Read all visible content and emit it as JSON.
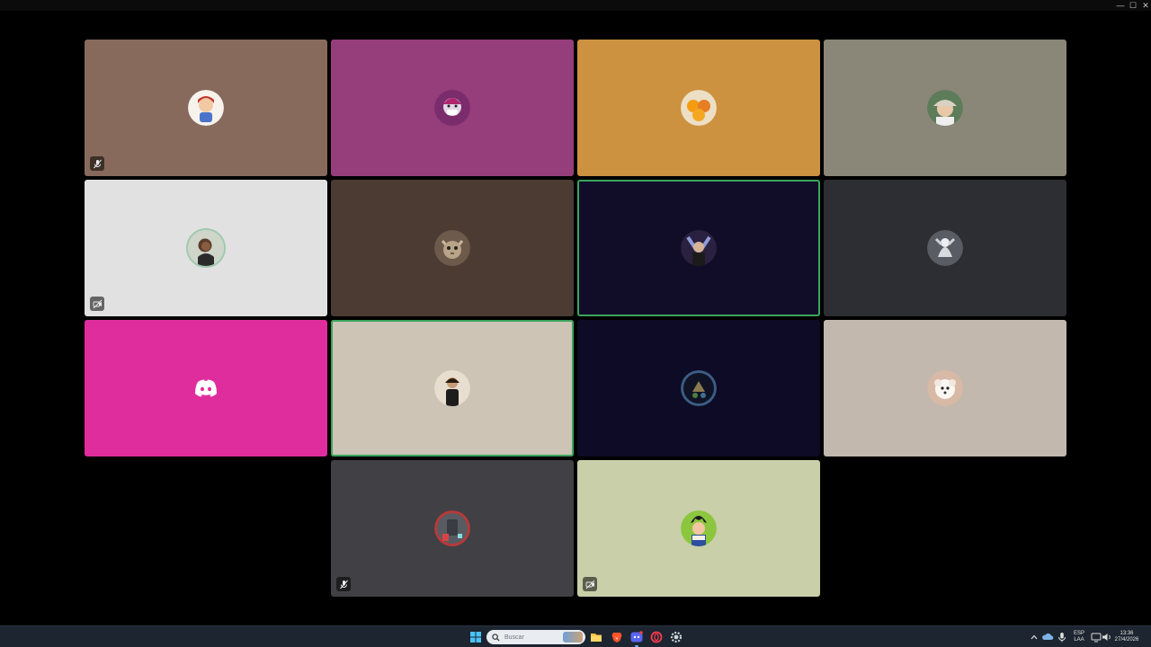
{
  "window": {
    "controls": {
      "minimize": "—",
      "maximize": "☐",
      "close": "✕"
    }
  },
  "tiles": [
    {
      "bg": "#876a5c",
      "avatar": "chibi-character-avatar",
      "status": "mic-muted-icon"
    },
    {
      "bg": "#963d7c",
      "avatar": "masked-character-avatar",
      "status": null
    },
    {
      "bg": "#cc923f",
      "avatar": "oranges-avatar",
      "status": null
    },
    {
      "bg": "#8a8678",
      "avatar": "person-with-cap-avatar",
      "status": null
    },
    {
      "bg": "#e1e1e2",
      "avatar": "person-photo-avatar",
      "status": "video-off-icon",
      "speaking_ring": true
    },
    {
      "bg": "#4b3b32",
      "avatar": "cat-avatar",
      "status": null
    },
    {
      "bg": "#110d28",
      "avatar": "figure-with-raised-arms-avatar",
      "status": null,
      "speaking": true
    },
    {
      "bg": "#2d2e33",
      "avatar": "grey-figure-avatar",
      "status": null
    },
    {
      "bg": "#e02d9e",
      "avatar": "discord-logo-icon",
      "status": null
    },
    {
      "bg": "#cdc4b6",
      "avatar": "person-in-black-shirt-avatar",
      "status": null,
      "speaking": true
    },
    {
      "bg": "#0d0b25",
      "avatar": "blue-ringed-avatar",
      "status": null
    },
    {
      "bg": "#c3b8ad",
      "avatar": "white-dog-avatar",
      "status": null
    },
    {
      "bg": "#404045",
      "avatar": "red-ringed-avatar",
      "status": "mic-muted-icon"
    },
    {
      "bg": "#c9cfa8",
      "avatar": "anime-character-avatar",
      "status": "video-off-icon"
    }
  ],
  "taskbar": {
    "search": {
      "placeholder": "Buscar"
    },
    "pinned": [
      "windows-start-icon",
      "file-explorer-icon",
      "brave-browser-icon",
      "discord-app-icon",
      "opera-gx-icon",
      "settings-icon"
    ],
    "tray": {
      "language_top": "ESP",
      "language_bottom": "LAA",
      "time": "13:36",
      "date": "27/4/2026"
    }
  }
}
